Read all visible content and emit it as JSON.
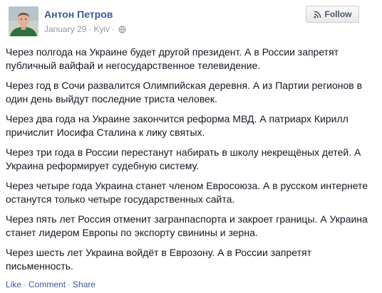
{
  "post": {
    "author": "Антон Петров",
    "date": "January 29",
    "separator": "·",
    "location": "Kyiv",
    "privacy_icon": "globe-icon",
    "follow_label": "Follow",
    "follow_icon": "rss-icon",
    "paragraphs": [
      "Через полгода на Украине будет другой президент. А в России запретят публичный вайфай и негосударственное телевидение.",
      "Через год в Сочи развалится Олимпийская деревня. А из Партии регионов в один день выйдут последние триста человек.",
      "Через два года на Украине закончится реформа МВД. А патриарх Кирилл причислит Иосифа Сталина к лику святых.",
      "Через три года в России перестанут набирать в школу некрещёных детей. А Украина реформирует судебную систему.",
      "Через четыре года Украина станет членом Евросоюза. А в русском интернете останутся только четыре государственных сайта.",
      "Через пять лет Россия отменит загранпаспорта и закроет границы. А Украина станет лидером Европы по экспорту свинины и зерна.",
      "Через шесть лет Украина войдёт в Еврозону. А в России запретят письменность."
    ],
    "actions": {
      "like": "Like",
      "comment": "Comment",
      "share": "Share",
      "dot": "·"
    }
  },
  "colors": {
    "link": "#3b5998",
    "meta": "#9197a3",
    "text": "#141823"
  }
}
